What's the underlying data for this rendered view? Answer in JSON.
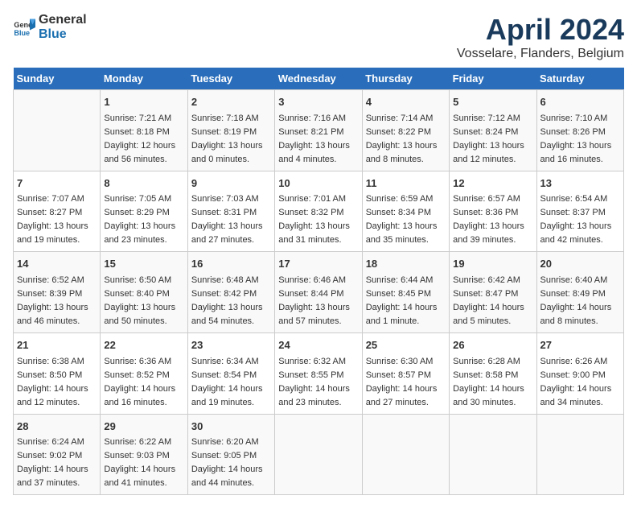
{
  "header": {
    "logo_general": "General",
    "logo_blue": "Blue",
    "title": "April 2024",
    "subtitle": "Vosselare, Flanders, Belgium"
  },
  "days_of_week": [
    "Sunday",
    "Monday",
    "Tuesday",
    "Wednesday",
    "Thursday",
    "Friday",
    "Saturday"
  ],
  "weeks": [
    [
      {
        "day": "",
        "content": ""
      },
      {
        "day": "1",
        "content": "Sunrise: 7:21 AM\nSunset: 8:18 PM\nDaylight: 12 hours\nand 56 minutes."
      },
      {
        "day": "2",
        "content": "Sunrise: 7:18 AM\nSunset: 8:19 PM\nDaylight: 13 hours\nand 0 minutes."
      },
      {
        "day": "3",
        "content": "Sunrise: 7:16 AM\nSunset: 8:21 PM\nDaylight: 13 hours\nand 4 minutes."
      },
      {
        "day": "4",
        "content": "Sunrise: 7:14 AM\nSunset: 8:22 PM\nDaylight: 13 hours\nand 8 minutes."
      },
      {
        "day": "5",
        "content": "Sunrise: 7:12 AM\nSunset: 8:24 PM\nDaylight: 13 hours\nand 12 minutes."
      },
      {
        "day": "6",
        "content": "Sunrise: 7:10 AM\nSunset: 8:26 PM\nDaylight: 13 hours\nand 16 minutes."
      }
    ],
    [
      {
        "day": "7",
        "content": "Sunrise: 7:07 AM\nSunset: 8:27 PM\nDaylight: 13 hours\nand 19 minutes."
      },
      {
        "day": "8",
        "content": "Sunrise: 7:05 AM\nSunset: 8:29 PM\nDaylight: 13 hours\nand 23 minutes."
      },
      {
        "day": "9",
        "content": "Sunrise: 7:03 AM\nSunset: 8:31 PM\nDaylight: 13 hours\nand 27 minutes."
      },
      {
        "day": "10",
        "content": "Sunrise: 7:01 AM\nSunset: 8:32 PM\nDaylight: 13 hours\nand 31 minutes."
      },
      {
        "day": "11",
        "content": "Sunrise: 6:59 AM\nSunset: 8:34 PM\nDaylight: 13 hours\nand 35 minutes."
      },
      {
        "day": "12",
        "content": "Sunrise: 6:57 AM\nSunset: 8:36 PM\nDaylight: 13 hours\nand 39 minutes."
      },
      {
        "day": "13",
        "content": "Sunrise: 6:54 AM\nSunset: 8:37 PM\nDaylight: 13 hours\nand 42 minutes."
      }
    ],
    [
      {
        "day": "14",
        "content": "Sunrise: 6:52 AM\nSunset: 8:39 PM\nDaylight: 13 hours\nand 46 minutes."
      },
      {
        "day": "15",
        "content": "Sunrise: 6:50 AM\nSunset: 8:40 PM\nDaylight: 13 hours\nand 50 minutes."
      },
      {
        "day": "16",
        "content": "Sunrise: 6:48 AM\nSunset: 8:42 PM\nDaylight: 13 hours\nand 54 minutes."
      },
      {
        "day": "17",
        "content": "Sunrise: 6:46 AM\nSunset: 8:44 PM\nDaylight: 13 hours\nand 57 minutes."
      },
      {
        "day": "18",
        "content": "Sunrise: 6:44 AM\nSunset: 8:45 PM\nDaylight: 14 hours\nand 1 minute."
      },
      {
        "day": "19",
        "content": "Sunrise: 6:42 AM\nSunset: 8:47 PM\nDaylight: 14 hours\nand 5 minutes."
      },
      {
        "day": "20",
        "content": "Sunrise: 6:40 AM\nSunset: 8:49 PM\nDaylight: 14 hours\nand 8 minutes."
      }
    ],
    [
      {
        "day": "21",
        "content": "Sunrise: 6:38 AM\nSunset: 8:50 PM\nDaylight: 14 hours\nand 12 minutes."
      },
      {
        "day": "22",
        "content": "Sunrise: 6:36 AM\nSunset: 8:52 PM\nDaylight: 14 hours\nand 16 minutes."
      },
      {
        "day": "23",
        "content": "Sunrise: 6:34 AM\nSunset: 8:54 PM\nDaylight: 14 hours\nand 19 minutes."
      },
      {
        "day": "24",
        "content": "Sunrise: 6:32 AM\nSunset: 8:55 PM\nDaylight: 14 hours\nand 23 minutes."
      },
      {
        "day": "25",
        "content": "Sunrise: 6:30 AM\nSunset: 8:57 PM\nDaylight: 14 hours\nand 27 minutes."
      },
      {
        "day": "26",
        "content": "Sunrise: 6:28 AM\nSunset: 8:58 PM\nDaylight: 14 hours\nand 30 minutes."
      },
      {
        "day": "27",
        "content": "Sunrise: 6:26 AM\nSunset: 9:00 PM\nDaylight: 14 hours\nand 34 minutes."
      }
    ],
    [
      {
        "day": "28",
        "content": "Sunrise: 6:24 AM\nSunset: 9:02 PM\nDaylight: 14 hours\nand 37 minutes."
      },
      {
        "day": "29",
        "content": "Sunrise: 6:22 AM\nSunset: 9:03 PM\nDaylight: 14 hours\nand 41 minutes."
      },
      {
        "day": "30",
        "content": "Sunrise: 6:20 AM\nSunset: 9:05 PM\nDaylight: 14 hours\nand 44 minutes."
      },
      {
        "day": "",
        "content": ""
      },
      {
        "day": "",
        "content": ""
      },
      {
        "day": "",
        "content": ""
      },
      {
        "day": "",
        "content": ""
      }
    ]
  ]
}
